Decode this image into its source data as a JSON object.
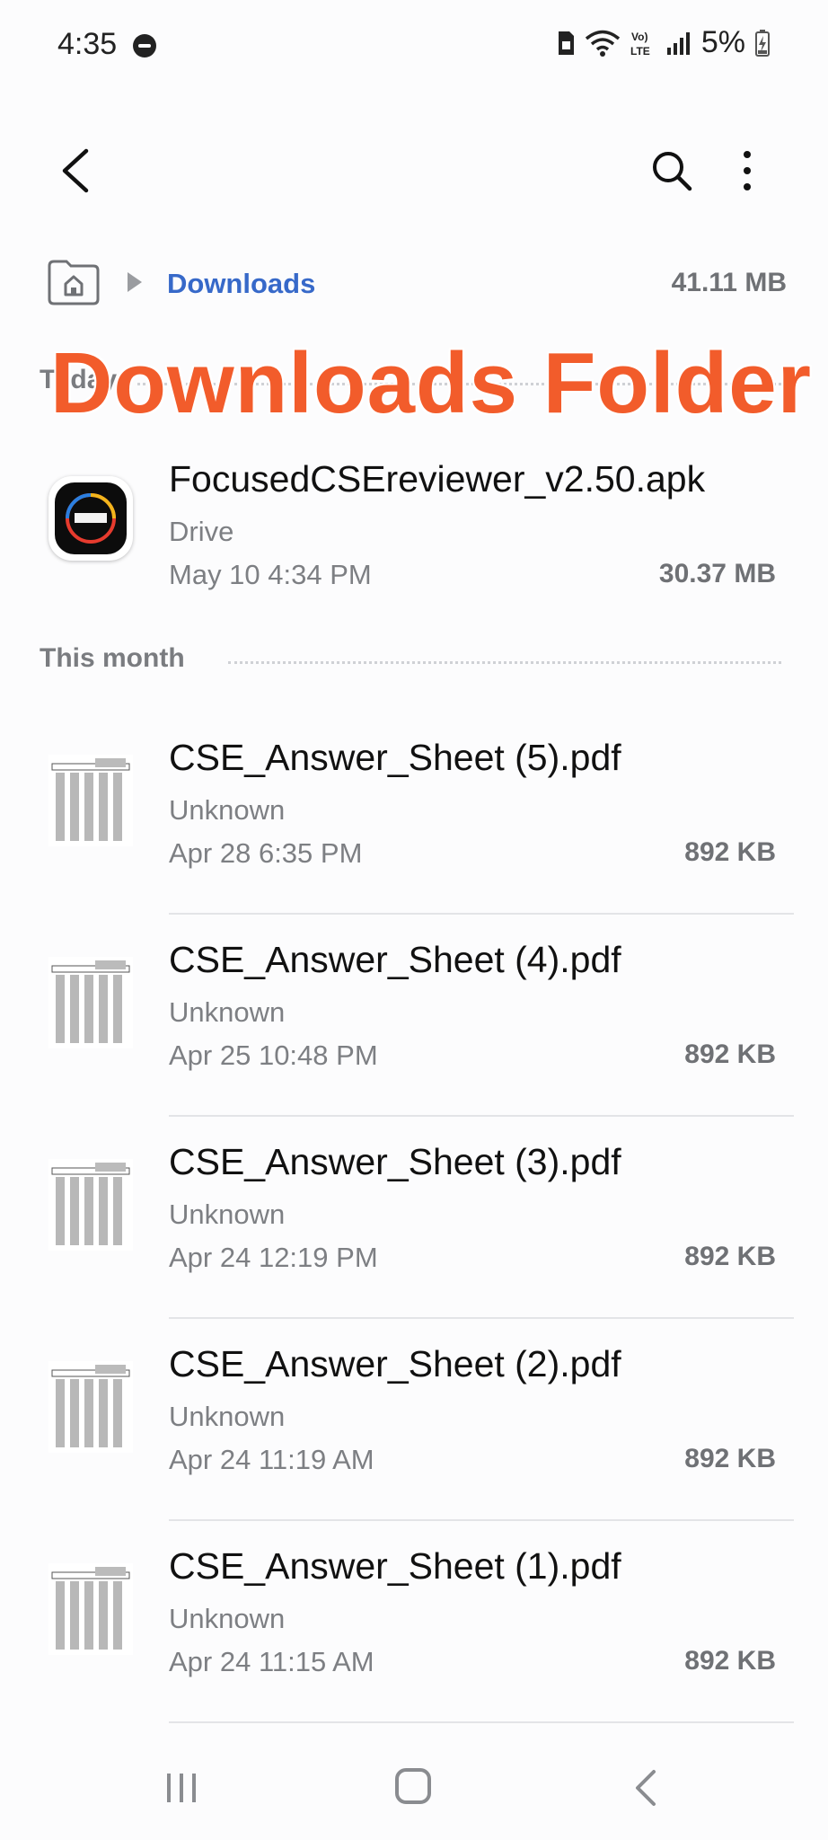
{
  "status_bar": {
    "time": "4:35",
    "battery_percent": "5%",
    "icons": [
      "do-not-disturb-icon",
      "sim-icon",
      "wifi-icon",
      "volte-icon",
      "signal-icon",
      "battery-charging-icon"
    ]
  },
  "app_bar": {
    "back_icon": "back-arrow-icon",
    "search_icon": "search-icon",
    "more_icon": "more-vertical-icon"
  },
  "breadcrumb": {
    "home_icon": "home-folder-icon",
    "current_folder": "Downloads",
    "folder_size": "41.11 MB"
  },
  "overlay_title": "Downloads Folder",
  "sections": {
    "today": {
      "label": "Today"
    },
    "this_month": {
      "label": "This month"
    }
  },
  "files_today": [
    {
      "name": "FocusedCSEreviewer_v2.50.apk",
      "source": "Drive",
      "date": "May 10 4:34 PM",
      "size": "30.37 MB",
      "icon": "apk-app-icon"
    }
  ],
  "files_this_month": [
    {
      "name": "CSE_Answer_Sheet (5).pdf",
      "source": "Unknown",
      "date": "Apr 28 6:35 PM",
      "size": "892 KB",
      "icon": "pdf-thumbnail-icon"
    },
    {
      "name": "CSE_Answer_Sheet (4).pdf",
      "source": "Unknown",
      "date": "Apr 25 10:48 PM",
      "size": "892 KB",
      "icon": "pdf-thumbnail-icon"
    },
    {
      "name": "CSE_Answer_Sheet (3).pdf",
      "source": "Unknown",
      "date": "Apr 24 12:19 PM",
      "size": "892 KB",
      "icon": "pdf-thumbnail-icon"
    },
    {
      "name": "CSE_Answer_Sheet (2).pdf",
      "source": "Unknown",
      "date": "Apr 24 11:19 AM",
      "size": "892 KB",
      "icon": "pdf-thumbnail-icon"
    },
    {
      "name": "CSE_Answer_Sheet (1).pdf",
      "source": "Unknown",
      "date": "Apr 24 11:15 AM",
      "size": "892 KB",
      "icon": "pdf-thumbnail-icon"
    }
  ],
  "colors": {
    "accent": "#3769c9",
    "overlay": "#f25c2b",
    "secondary_text": "#7d7f83"
  },
  "nav_bar": {
    "icons": [
      "recents-icon",
      "home-icon",
      "back-icon"
    ]
  }
}
